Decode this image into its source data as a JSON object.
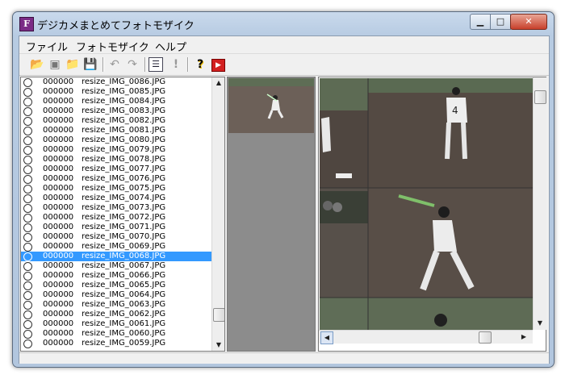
{
  "window": {
    "title": "デジカメまとめてフォトモザイク",
    "app_icon_letter": "F"
  },
  "caption_buttons": {
    "minimize": "▁",
    "maximize": "□",
    "close": "✕"
  },
  "menu": [
    {
      "label": "ファイル"
    },
    {
      "label": "フォトモザイク"
    },
    {
      "label": "ヘルプ"
    }
  ],
  "toolbar": {
    "items": [
      {
        "name": "open-folder-icon",
        "glyph": "📂"
      },
      {
        "name": "open-dark-icon",
        "glyph": "▣"
      },
      {
        "name": "folder-icon",
        "glyph": "📁"
      },
      {
        "name": "save-icon",
        "glyph": "💾"
      },
      {
        "name": "undo-icon",
        "glyph": "↶"
      },
      {
        "name": "redo-icon",
        "glyph": "↷"
      },
      {
        "name": "list-window-icon",
        "glyph": "☰"
      },
      {
        "name": "exclamation-icon",
        "glyph": "!"
      },
      {
        "name": "help-icon",
        "glyph": "?"
      },
      {
        "name": "exit-icon",
        "glyph": "▶"
      }
    ]
  },
  "file_list": {
    "selected_index": 18,
    "rows": [
      {
        "count": "000000",
        "file": "resize_IMG_0086.JPG"
      },
      {
        "count": "000000",
        "file": "resize_IMG_0085.JPG"
      },
      {
        "count": "000000",
        "file": "resize_IMG_0084.JPG"
      },
      {
        "count": "000000",
        "file": "resize_IMG_0083.JPG"
      },
      {
        "count": "000000",
        "file": "resize_IMG_0082.JPG"
      },
      {
        "count": "000000",
        "file": "resize_IMG_0081.JPG"
      },
      {
        "count": "000000",
        "file": "resize_IMG_0080.JPG"
      },
      {
        "count": "000000",
        "file": "resize_IMG_0079.JPG"
      },
      {
        "count": "000000",
        "file": "resize_IMG_0078.JPG"
      },
      {
        "count": "000000",
        "file": "resize_IMG_0077.JPG"
      },
      {
        "count": "000000",
        "file": "resize_IMG_0076.JPG"
      },
      {
        "count": "000000",
        "file": "resize_IMG_0075.JPG"
      },
      {
        "count": "000000",
        "file": "resize_IMG_0074.JPG"
      },
      {
        "count": "000000",
        "file": "resize_IMG_0073.JPG"
      },
      {
        "count": "000000",
        "file": "resize_IMG_0072.JPG"
      },
      {
        "count": "000000",
        "file": "resize_IMG_0071.JPG"
      },
      {
        "count": "000000",
        "file": "resize_IMG_0070.JPG"
      },
      {
        "count": "000000",
        "file": "resize_IMG_0069.JPG"
      },
      {
        "count": "000000",
        "file": "resize_IMG_0068.JPG"
      },
      {
        "count": "000000",
        "file": "resize_IMG_0067.JPG"
      },
      {
        "count": "000000",
        "file": "resize_IMG_0066.JPG"
      },
      {
        "count": "000000",
        "file": "resize_IMG_0065.JPG"
      },
      {
        "count": "000000",
        "file": "resize_IMG_0064.JPG"
      },
      {
        "count": "000000",
        "file": "resize_IMG_0063.JPG"
      },
      {
        "count": "000000",
        "file": "resize_IMG_0062.JPG"
      },
      {
        "count": "000000",
        "file": "resize_IMG_0061.JPG"
      },
      {
        "count": "000000",
        "file": "resize_IMG_0060.JPG"
      },
      {
        "count": "000000",
        "file": "resize_IMG_0059.JPG"
      }
    ]
  },
  "scroll_arrows": {
    "up": "▲",
    "down": "▼",
    "left": "◀",
    "right": "▶"
  },
  "colors": {
    "selection": "#3399ff",
    "field_dirt": "#5a4f48",
    "grass": "#5f6f5a"
  }
}
